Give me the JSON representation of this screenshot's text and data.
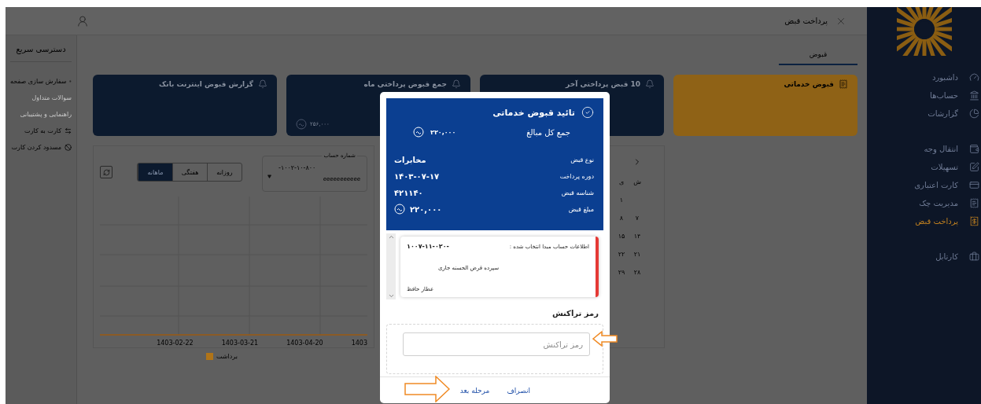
{
  "sidebar": {
    "groups": [
      {
        "items": [
          {
            "label": "داشبورد",
            "selected": false
          },
          {
            "label": "حساب‌ها",
            "selected": false
          },
          {
            "label": "گزارشات",
            "selected": false
          }
        ]
      },
      {
        "items": [
          {
            "label": "انتقال وجه",
            "selected": false
          },
          {
            "label": "تسهیلات",
            "selected": false
          },
          {
            "label": "کارت اعتباری",
            "selected": false
          },
          {
            "label": "مدیریت چک",
            "selected": false
          },
          {
            "label": "پرداخت قبض",
            "selected": true
          }
        ]
      },
      {
        "items": [
          {
            "label": "کارتابل",
            "selected": false
          }
        ]
      }
    ]
  },
  "header": {
    "title": "پرداخت قبض"
  },
  "quick_access": {
    "title": "دسترسی سریع",
    "items": [
      {
        "label": "سفارش سازی صفحه",
        "disabled": false
      },
      {
        "label": "سوالات متداول",
        "disabled": true
      },
      {
        "label": "راهنمایی و پشتیبانی",
        "disabled": true
      },
      {
        "label": "کارت به کارت",
        "disabled": false
      },
      {
        "label": "مسدود کردن کارت",
        "disabled": false
      }
    ]
  },
  "tabs": [
    {
      "label": "قبوض",
      "selected": true
    }
  ],
  "cards": [
    {
      "kind": "service",
      "title": "قبوض خدماتی"
    },
    {
      "kind": "info",
      "title": "10 قبض پرداختی آخر"
    },
    {
      "kind": "info",
      "title": "جمع قبوض پرداختی ماه",
      "amount": "۲۵۶,۰۰۰"
    },
    {
      "kind": "info",
      "title": "گزارش قبوض اینترنت بانک"
    }
  ],
  "calendar": {
    "columns": [
      {
        "weekday": "ش",
        "days": [
          "۷",
          "۱۴",
          "۲۱",
          "۲۸"
        ]
      },
      {
        "weekday": "ی",
        "days": [
          "۱",
          "۸",
          "۱۵",
          "۲۲",
          "۲۹"
        ]
      }
    ]
  },
  "account_selector": {
    "label": "شماره حساب",
    "account": "۱۰۰۲-۱۰-۸۰۰-",
    "owner": "eeeeeeeeeee"
  },
  "period_tabs": [
    {
      "label": "روزانه",
      "selected": false
    },
    {
      "label": "هفتگی",
      "selected": false
    },
    {
      "label": "ماهانه",
      "selected": true
    }
  ],
  "chart": {
    "x_labels": [
      "1403",
      "1403-04-20",
      "1403-03-21",
      "1403-02-22"
    ],
    "legend": "برداشت"
  },
  "modal": {
    "title": "تائید قبوض خدماتی",
    "total_label": "جمع کل مبالغ",
    "total": "۲۲۰,۰۰۰",
    "rows": [
      {
        "label": "نوع قبض",
        "value": "مخابرات",
        "currency": false
      },
      {
        "label": "دوره پرداخت",
        "value": "۱۴۰۳-۰۷-۱۷",
        "currency": false
      },
      {
        "label": "شناسه قبض",
        "value": "۴۲۱۱۴۰",
        "currency": false
      },
      {
        "label": "مبلغ قبض",
        "value": "۲۲۰,۰۰۰",
        "currency": true
      }
    ],
    "account": {
      "title": "اطلاعات حساب مبدا انتخاب شده :",
      "number": "۱۰۰۷-۱۱-۰۲۰-",
      "type": "سپرده قرض الحسنه جاری",
      "owner": "عطار حافظ"
    },
    "password": {
      "label": "رمز تراکنش",
      "placeholder": "رمز تراکنش"
    },
    "buttons": [
      {
        "label": "انصراف"
      },
      {
        "label": "مرحله بعد"
      }
    ]
  }
}
